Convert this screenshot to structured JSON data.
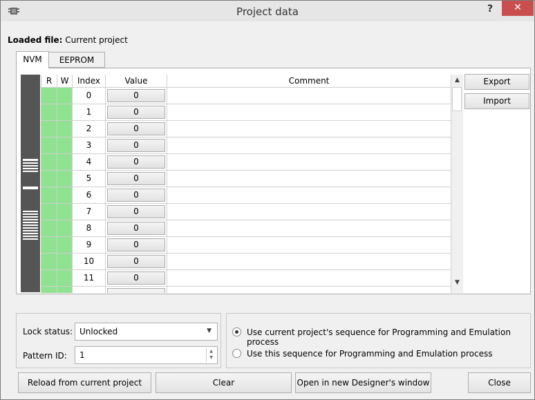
{
  "window": {
    "title": "Project data",
    "help_label": "?",
    "close_glyph": "✕"
  },
  "loaded": {
    "label": "Loaded file:",
    "value": "Current project"
  },
  "tabs": [
    {
      "label": "NVM",
      "active": true
    },
    {
      "label": "EEPROM",
      "active": false
    }
  ],
  "table": {
    "columns": [
      "R",
      "W",
      "Index",
      "Value",
      "Comment"
    ],
    "rows": [
      {
        "index": "0",
        "value": "0",
        "comment": ""
      },
      {
        "index": "1",
        "value": "0",
        "comment": ""
      },
      {
        "index": "2",
        "value": "0",
        "comment": ""
      },
      {
        "index": "3",
        "value": "0",
        "comment": ""
      },
      {
        "index": "4",
        "value": "0",
        "comment": ""
      },
      {
        "index": "5",
        "value": "0",
        "comment": ""
      },
      {
        "index": "6",
        "value": "0",
        "comment": ""
      },
      {
        "index": "7",
        "value": "0",
        "comment": ""
      },
      {
        "index": "8",
        "value": "0",
        "comment": ""
      },
      {
        "index": "9",
        "value": "0",
        "comment": ""
      },
      {
        "index": "10",
        "value": "0",
        "comment": ""
      },
      {
        "index": "11",
        "value": "0",
        "comment": ""
      }
    ]
  },
  "side_buttons": {
    "export": "Export",
    "import": "Import"
  },
  "lock": {
    "label": "Lock status:",
    "value": "Unlocked"
  },
  "pattern": {
    "label": "Pattern ID:",
    "value": "1"
  },
  "sequence_options": {
    "option1": "Use current project's sequence for Programming and Emulation process",
    "option2": "Use this sequence for Programming and Emulation process",
    "selected": 1
  },
  "footer": {
    "reload": "Reload from current project",
    "clear": "Clear",
    "open": "Open in new Designer's window",
    "close": "Close"
  },
  "colors": {
    "rw_cell": "#8fe28f",
    "close_button": "#c94f4f"
  }
}
